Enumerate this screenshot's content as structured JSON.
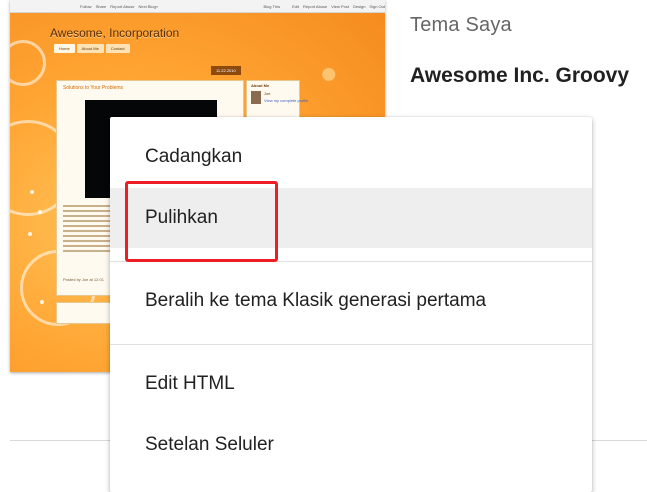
{
  "theme_preview": {
    "blog_title": "Awesome, Incorporation",
    "tabs": [
      "Home",
      "About Me",
      "Contact"
    ],
    "date": "11.22.2010",
    "post_title": "Solutions to Your Problems",
    "posted_by": "Posted by Joe at 12:01",
    "sidebar_title": "About Me",
    "sidebar_name": "Joe",
    "sidebar_link": "View my complete profile",
    "navbar_left": [
      "Follow",
      "Share",
      "Report Abuse",
      "Next Blog»"
    ],
    "navbar_right": [
      "Blog This",
      "Edit",
      "Report Abuse",
      "View Post",
      "Design",
      "Sign Out"
    ]
  },
  "header": {
    "section_label": "Tema Saya",
    "theme_name": "Awesome Inc. Groovy"
  },
  "menu": {
    "items": [
      {
        "label": "Cadangkan"
      },
      {
        "label": "Pulihkan"
      },
      {
        "label": "Beralih ke tema Klasik generasi pertama"
      },
      {
        "label": "Edit HTML"
      },
      {
        "label": "Setelan Seluler"
      }
    ]
  },
  "colors": {
    "highlight": "#ee1c25",
    "accent": "#e8752c"
  }
}
